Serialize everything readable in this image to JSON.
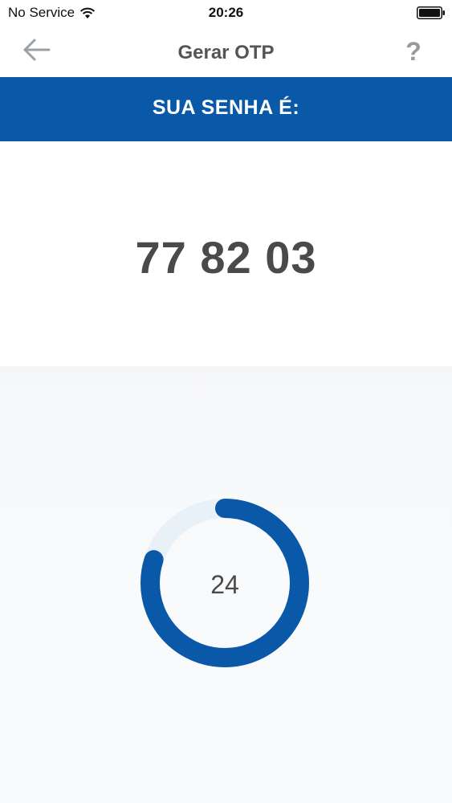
{
  "status_bar": {
    "carrier": "No Service",
    "time": "20:26",
    "icons": [
      "wifi-icon",
      "battery-icon"
    ]
  },
  "nav": {
    "title": "Gerar OTP",
    "back_icon": "arrow-left-icon",
    "help_label": "?"
  },
  "banner": {
    "text": "SUA SENHA É:"
  },
  "otp": {
    "code": "77 82 03"
  },
  "timer": {
    "seconds_remaining": "24",
    "fraction_remaining": 0.8
  },
  "colors": {
    "brand_blue": "#0a58a8",
    "ring_track": "#e8f0f8",
    "text_dark": "#4a4a4a",
    "text_muted": "#9a9a9a"
  }
}
